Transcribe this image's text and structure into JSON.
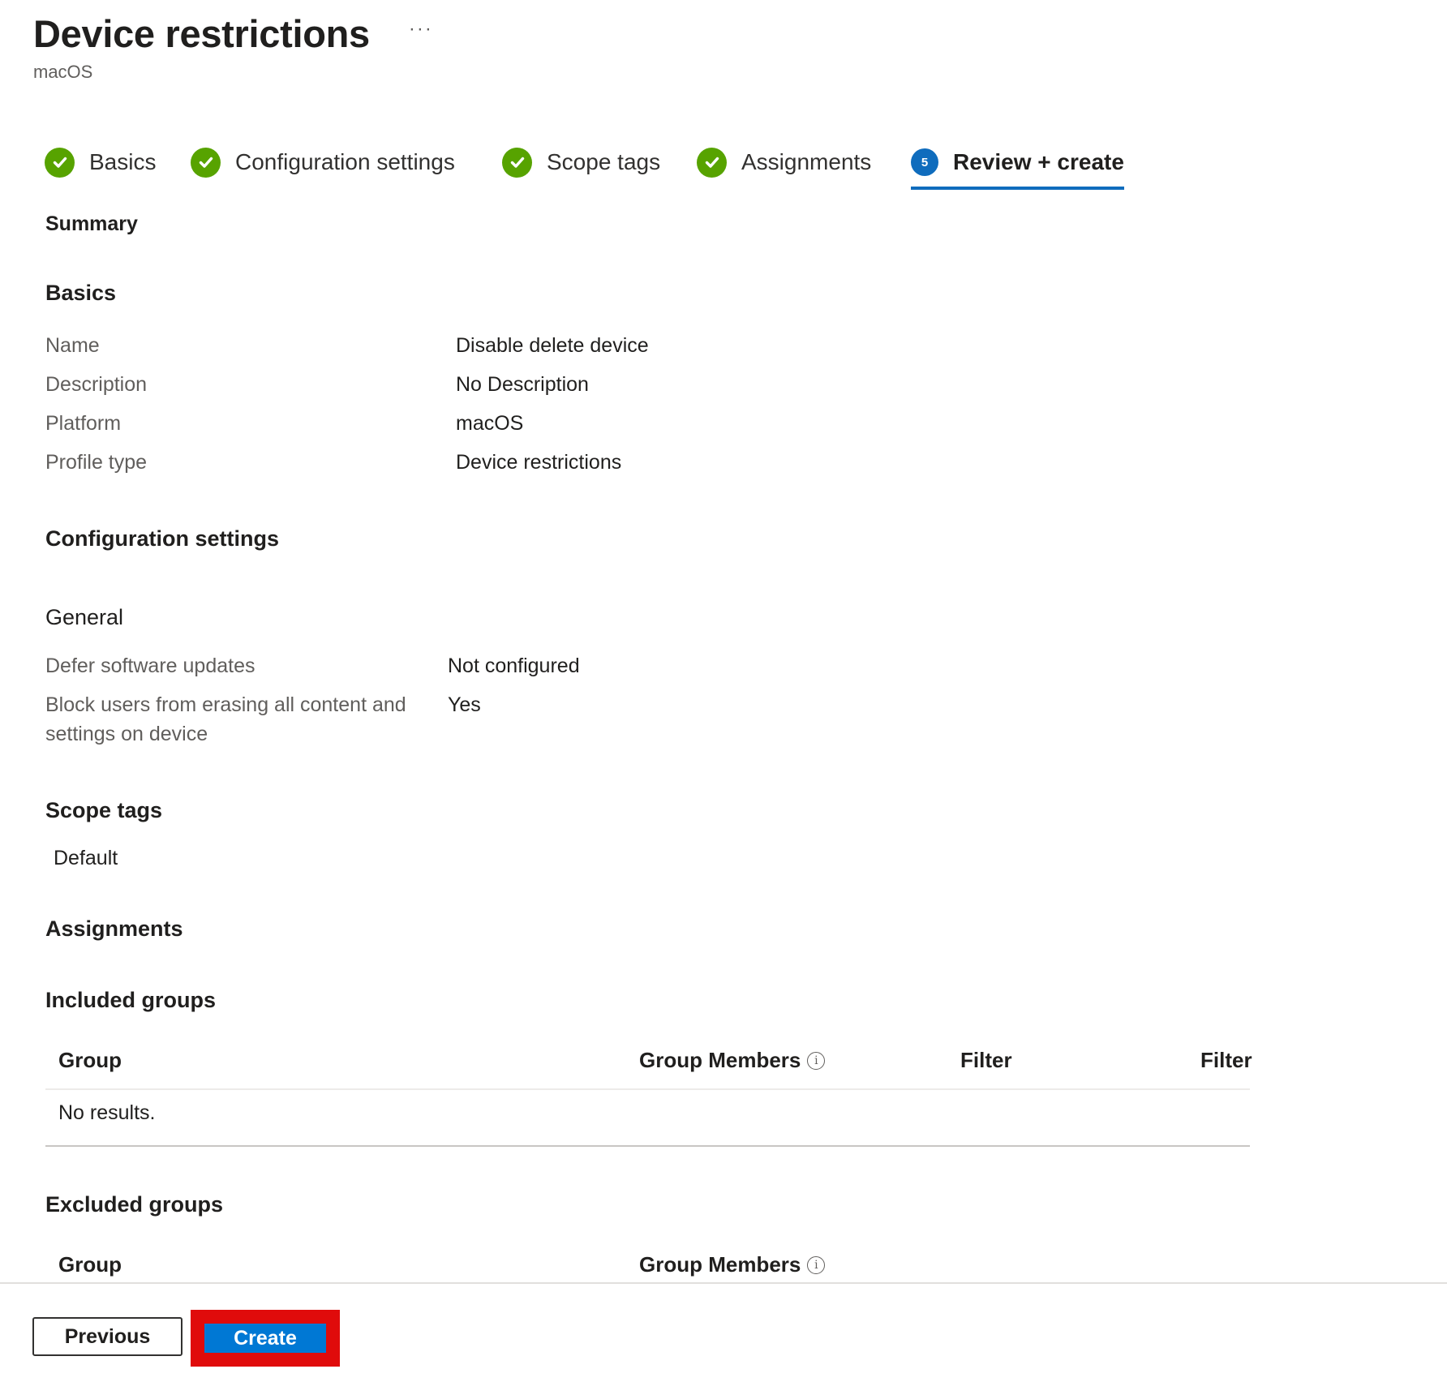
{
  "header": {
    "title": "Device restrictions",
    "more_label": "···",
    "subtitle": "macOS"
  },
  "tabs": [
    {
      "label": "Basics",
      "status": "complete",
      "icon": "check-circle-icon"
    },
    {
      "label": "Configuration settings",
      "status": "complete",
      "icon": "check-circle-icon"
    },
    {
      "label": "Scope tags",
      "status": "complete",
      "icon": "check-circle-icon"
    },
    {
      "label": "Assignments",
      "status": "complete",
      "icon": "check-circle-icon"
    },
    {
      "label": "Review + create",
      "status": "current",
      "step": "5"
    }
  ],
  "summary": {
    "title": "Summary",
    "basics": {
      "title": "Basics",
      "rows": [
        {
          "label": "Name",
          "value": "Disable delete device"
        },
        {
          "label": "Description",
          "value": "No Description"
        },
        {
          "label": "Platform",
          "value": "macOS"
        },
        {
          "label": "Profile type",
          "value": "Device restrictions"
        }
      ]
    },
    "configuration": {
      "title": "Configuration settings",
      "group": "General",
      "rows": [
        {
          "label": "Defer software updates",
          "value": "Not configured"
        },
        {
          "label_line1": "Block users from erasing all content and",
          "label_line2": "settings on device",
          "value": "Yes"
        }
      ]
    },
    "scope_tags": {
      "title": "Scope tags",
      "values": [
        "Default"
      ]
    },
    "assignments": {
      "title": "Assignments",
      "included": {
        "title": "Included groups",
        "columns": [
          "Group",
          "Group Members",
          "Filter",
          "Filter"
        ],
        "empty_text": "No results."
      },
      "excluded": {
        "title": "Excluded groups",
        "columns": [
          "Group",
          "Group Members"
        ]
      }
    }
  },
  "footer": {
    "previous_label": "Previous",
    "create_label": "Create"
  },
  "colors": {
    "complete": "#57a300",
    "accent": "#0f6cbd",
    "primary_button": "#0078d4",
    "highlight": "#e00b0b"
  }
}
